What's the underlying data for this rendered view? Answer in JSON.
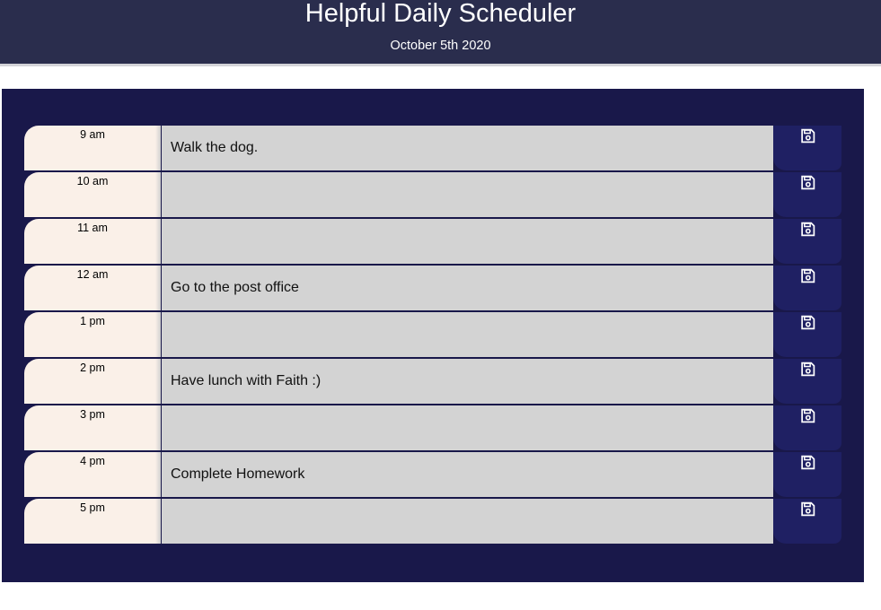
{
  "header": {
    "title": "Helpful Daily Scheduler",
    "date": "October 5th 2020"
  },
  "save_icon": "save-icon",
  "colors": {
    "header_bg": "#2a2d4d",
    "panel_bg": "#19184a",
    "hour_bg": "#faf0e8",
    "task_bg": "#d3d3d3",
    "save_bg": "#1f2063"
  },
  "rows": [
    {
      "hour": "9 am",
      "task": "Walk the dog."
    },
    {
      "hour": "10 am",
      "task": ""
    },
    {
      "hour": "11 am",
      "task": ""
    },
    {
      "hour": "12 am",
      "task": "Go to the post office"
    },
    {
      "hour": "1 pm",
      "task": ""
    },
    {
      "hour": "2 pm",
      "task": "Have lunch with Faith :)"
    },
    {
      "hour": "3 pm",
      "task": ""
    },
    {
      "hour": "4 pm",
      "task": "Complete Homework"
    },
    {
      "hour": "5 pm",
      "task": ""
    }
  ]
}
